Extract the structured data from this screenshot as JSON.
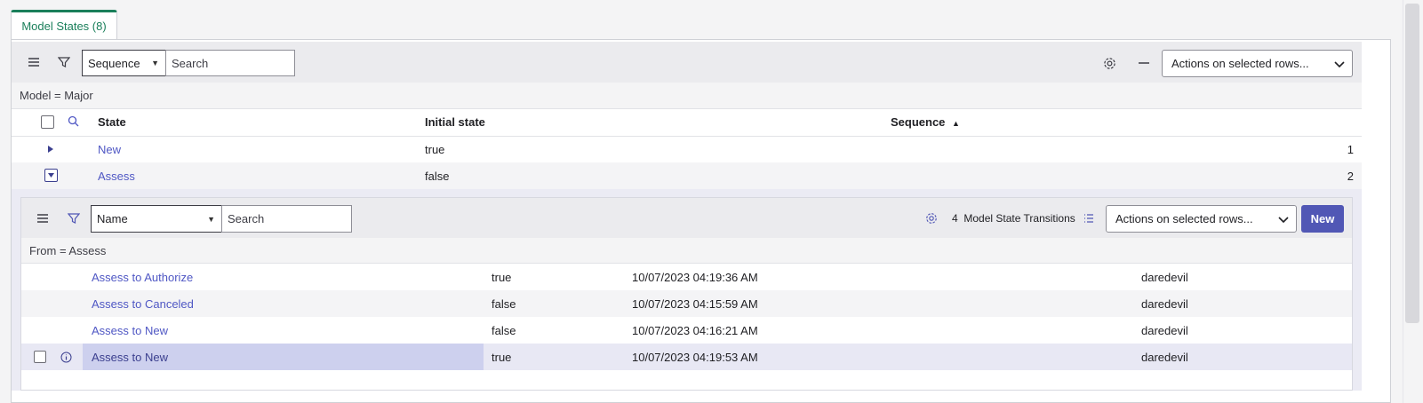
{
  "tab": {
    "label": "Model States (8)"
  },
  "outer": {
    "list_menu_icon": "hamburger-icon",
    "filter_icon": "funnel-icon",
    "search_field": "Sequence",
    "search_placeholder": "Search",
    "actions_label": "Actions on selected rows...",
    "breadcrumb": "Model = Major",
    "columns": {
      "state": "State",
      "initial": "Initial state",
      "sequence": "Sequence"
    },
    "rows": [
      {
        "state": "New",
        "initial": "true",
        "sequence": "1"
      },
      {
        "state": "Assess",
        "initial": "false",
        "sequence": "2"
      }
    ]
  },
  "inner": {
    "search_field": "Name",
    "search_placeholder": "Search",
    "record_count": "4",
    "record_label": "Model State Transitions",
    "actions_label": "Actions on selected rows...",
    "new_label": "New",
    "breadcrumb": "From = Assess",
    "rows": [
      {
        "name": "Assess to Authorize",
        "value": "true",
        "updated": "10/07/2023 04:19:36 AM",
        "user": "daredevil"
      },
      {
        "name": "Assess to Canceled",
        "value": "false",
        "updated": "10/07/2023 04:15:59 AM",
        "user": "daredevil"
      },
      {
        "name": "Assess to New",
        "value": "false",
        "updated": "10/07/2023 04:16:21 AM",
        "user": "daredevil"
      },
      {
        "name": "Assess to New",
        "value": "true",
        "updated": "10/07/2023 04:19:53 AM",
        "user": "daredevil"
      }
    ]
  },
  "colors": {
    "accent": "#1a7f5a",
    "link": "#4f57c4",
    "primary_button": "#5157b5",
    "hover_row": "#e8e8f4",
    "selected_cell": "#cdd0ee"
  }
}
